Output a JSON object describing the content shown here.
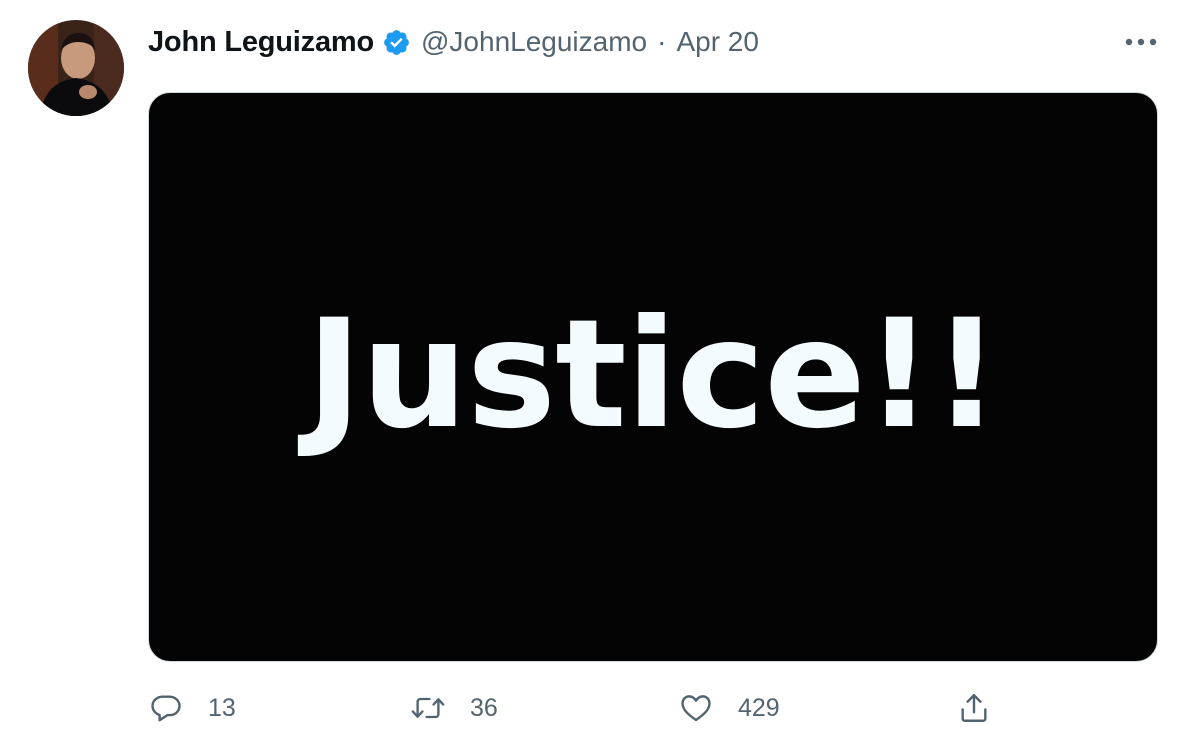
{
  "author": {
    "display_name": "John Leguizamo",
    "handle": "@JohnLeguizamo",
    "separator": "·",
    "date": "Apr 20",
    "verified": true,
    "avatar_icon": "profile-photo"
  },
  "media": {
    "text": "Justice!!",
    "background_color": "#040404",
    "text_color": "#f4fbff"
  },
  "actions": {
    "reply": {
      "icon": "reply-icon",
      "count": "13"
    },
    "retweet": {
      "icon": "retweet-icon",
      "count": "36"
    },
    "like": {
      "icon": "heart-icon",
      "count": "429"
    },
    "share": {
      "icon": "share-icon"
    }
  },
  "more_icon": "more-icon",
  "colors": {
    "verified_blue": "#1d9bf0",
    "secondary_text": "#536471",
    "primary_text": "#0f1419"
  }
}
